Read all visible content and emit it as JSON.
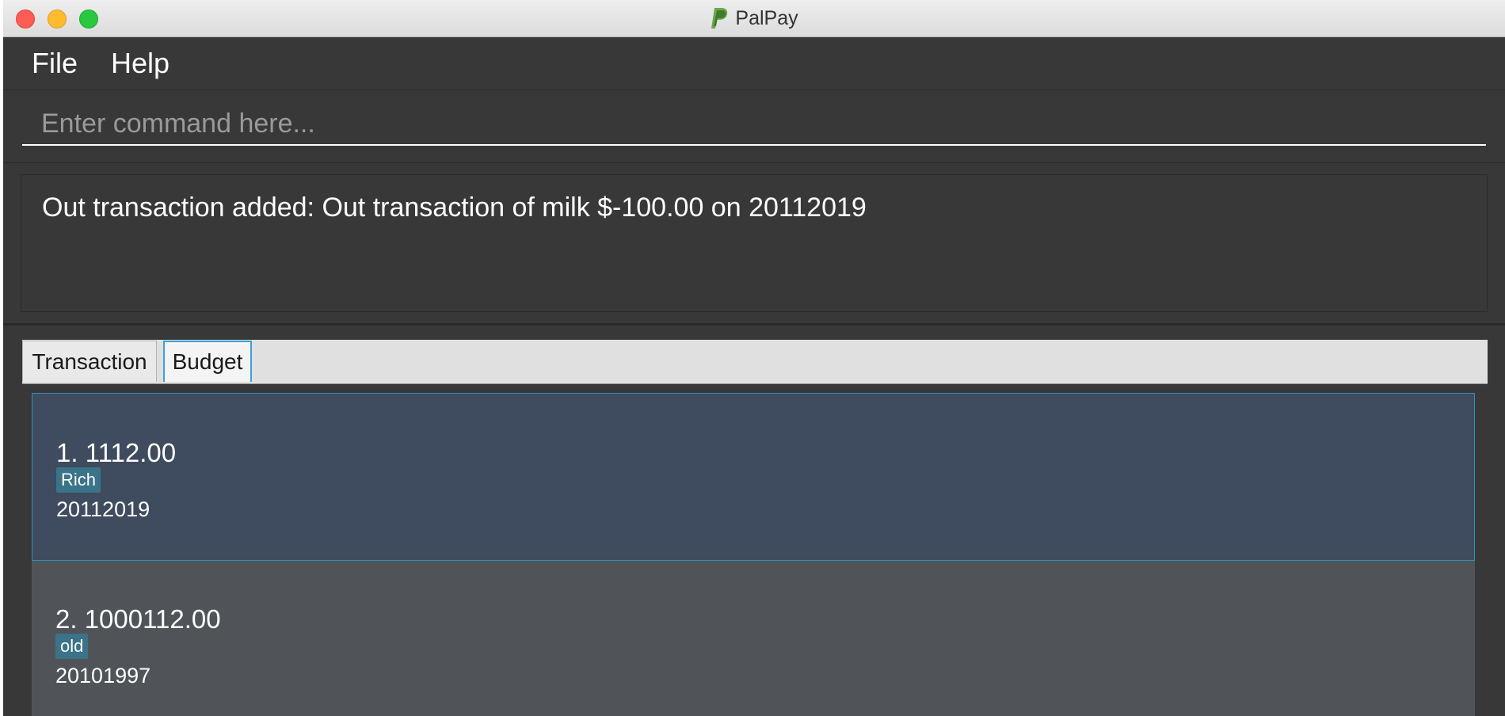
{
  "window": {
    "title": "PalPay",
    "logo_icon": "paypal-logo-icon"
  },
  "menu": {
    "file": "File",
    "help": "Help"
  },
  "command": {
    "placeholder": "Enter command here...",
    "value": ""
  },
  "result": {
    "text": "Out transaction added: Out transaction of milk $-100.00 on 20112019"
  },
  "tabs": [
    {
      "label": "Transaction",
      "selected": false
    },
    {
      "label": "Budget",
      "selected": true
    }
  ],
  "budgets": [
    {
      "title": "1.  1112.00",
      "tag": "Rich",
      "date": "20112019",
      "selected": true
    },
    {
      "title": "2.  1000112.00",
      "tag": "old",
      "date": "20101997",
      "selected": false
    }
  ],
  "colors": {
    "background": "#383838",
    "selected_card": "#3f4b5e",
    "card": "#505458",
    "tag": "#3b7389",
    "tab_focus": "#3aa0d6"
  }
}
